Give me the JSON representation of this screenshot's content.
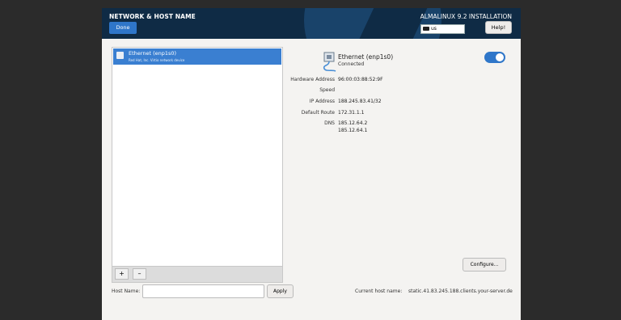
{
  "header": {
    "title": "NETWORK & HOST NAME",
    "done_label": "Done",
    "product": "ALMALINUX 9.2 INSTALLATION",
    "keyboard_layout": "us",
    "help_label": "Help!"
  },
  "devices": [
    {
      "name": "Ethernet (enp1s0)",
      "description": "Red Hat, Inc. Virtio network device"
    }
  ],
  "toolbar": {
    "add_label": "+",
    "remove_label": "–"
  },
  "details": {
    "name": "Ethernet (enp1s0)",
    "status": "Connected",
    "enabled": true,
    "rows": [
      {
        "label": "Hardware Address",
        "value": "96:00:03:88:52:9F"
      },
      {
        "label": "Speed",
        "value": ""
      },
      {
        "label": "IP Address",
        "value": "188.245.83.41/32"
      },
      {
        "label": "Default Route",
        "value": "172.31.1.1"
      },
      {
        "label": "DNS",
        "value": "185.12.64.2"
      }
    ],
    "dns_secondary": "185.12.64.1",
    "configure_label": "Configure..."
  },
  "hostname": {
    "label": "Host Name:",
    "value": "",
    "placeholder": "",
    "apply_label": "Apply",
    "current_label": "Current host name:",
    "current_value": "static.41.83.245.188.clients.your-server.de"
  },
  "colors": {
    "header_bg": "#0f2b45",
    "accent": "#2f76c9",
    "selection": "#3a7fd1",
    "window_bg": "#f4f3f1"
  }
}
